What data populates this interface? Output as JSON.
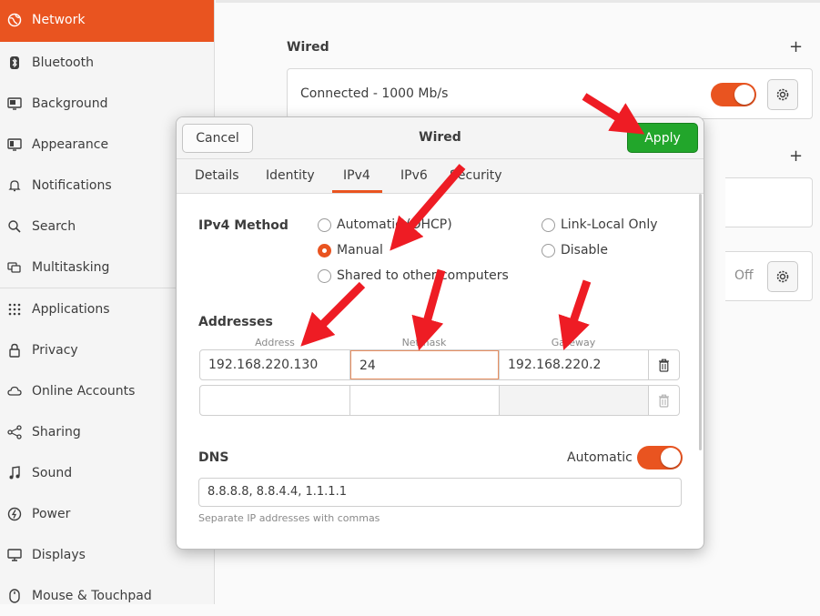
{
  "sidebar": {
    "items": [
      {
        "label": "Network",
        "icon": "network-icon"
      },
      {
        "label": "Bluetooth",
        "icon": "bluetooth-icon"
      },
      {
        "label": "Background",
        "icon": "background-icon"
      },
      {
        "label": "Appearance",
        "icon": "appearance-icon"
      },
      {
        "label": "Notifications",
        "icon": "bell-icon"
      },
      {
        "label": "Search",
        "icon": "search-icon"
      },
      {
        "label": "Multitasking",
        "icon": "multitasking-icon"
      },
      {
        "label": "Applications",
        "icon": "applications-grid-icon"
      },
      {
        "label": "Privacy",
        "icon": "lock-icon"
      },
      {
        "label": "Online Accounts",
        "icon": "cloud-icon"
      },
      {
        "label": "Sharing",
        "icon": "share-icon"
      },
      {
        "label": "Sound",
        "icon": "music-note-icon"
      },
      {
        "label": "Power",
        "icon": "power-icon"
      },
      {
        "label": "Displays",
        "icon": "display-icon"
      },
      {
        "label": "Mouse & Touchpad",
        "icon": "mouse-icon"
      }
    ]
  },
  "main": {
    "wired_title": "Wired",
    "connection_status": "Connected - 1000 Mb/s",
    "off_label": "Off"
  },
  "dialog": {
    "title": "Wired",
    "cancel_label": "Cancel",
    "apply_label": "Apply",
    "tabs": [
      "Details",
      "Identity",
      "IPv4",
      "IPv6",
      "Security"
    ],
    "active_tab": "IPv4",
    "ipv4_method_label": "IPv4 Method",
    "methods": {
      "automatic": "Automatic (DHCP)",
      "manual": "Manual",
      "shared": "Shared to other computers",
      "link_local": "Link-Local Only",
      "disable": "Disable"
    },
    "selected_method": "Manual",
    "addresses_label": "Addresses",
    "columns": [
      "Address",
      "Netmask",
      "Gateway"
    ],
    "rows": [
      {
        "address": "192.168.220.130",
        "netmask": "24",
        "gateway": "192.168.220.2"
      },
      {
        "address": "",
        "netmask": "",
        "gateway": ""
      }
    ],
    "dns_label": "DNS",
    "dns_automatic_label": "Automatic",
    "dns_value": "8.8.8.8, 8.8.4.4, 1.1.1.1",
    "dns_hint": "Separate IP addresses with commas"
  },
  "colors": {
    "accent": "#e95420",
    "apply": "#22a62b",
    "arrow": "#ee1c24"
  }
}
